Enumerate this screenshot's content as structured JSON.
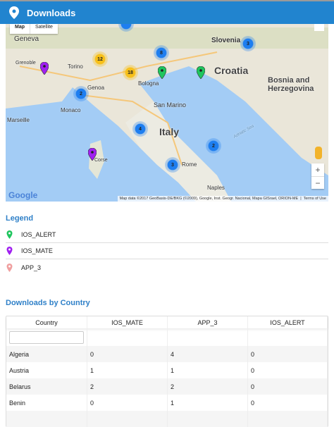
{
  "header": {
    "title": "Downloads",
    "icon": "map-marker-icon"
  },
  "map": {
    "map_type_buttons": [
      "Map",
      "Satellite"
    ],
    "labels": {
      "geneva": "Geneva",
      "slovenia": "Slovenia",
      "croatia": "Croatia",
      "bosnia": "Bosnia and Herzegovina",
      "grenoble": "Grenoble",
      "torino": "Torino",
      "genoa": "Genoa",
      "bologna": "Bologna",
      "monaco": "Monaco",
      "marseille": "Marseille",
      "san_marino": "San Marino",
      "italy": "Italy",
      "adriatic": "Adriatic Sea",
      "corse": "Corse",
      "rome": "Rome",
      "naples": "Naples"
    },
    "clusters": [
      "3",
      "8",
      "12",
      "18",
      "2",
      "4",
      "2",
      "3"
    ],
    "zoom_in": "+",
    "zoom_out": "−",
    "google": "Google",
    "attribution": "Map data ©2017 GeoBasis-DE/BKG (©2009), Google, Inst. Geogr. Nacional, Mapa GISrael, ORION-ME",
    "terms": "Terms of Use"
  },
  "legend": {
    "title": "Legend",
    "items": [
      {
        "label": "IOS_ALERT",
        "color": "#1fc55e"
      },
      {
        "label": "IOS_MATE",
        "color": "#a020f0"
      },
      {
        "label": "APP_3",
        "color": "#f0a0a0"
      }
    ]
  },
  "table": {
    "title": "Downloads by Country",
    "columns": [
      "Country",
      "IOS_MATE",
      "APP_3",
      "IOS_ALERT"
    ],
    "filter_placeholder": "",
    "rows": [
      [
        "Algeria",
        "0",
        "4",
        "0"
      ],
      [
        "Austria",
        "1",
        "1",
        "0"
      ],
      [
        "Belarus",
        "2",
        "2",
        "0"
      ],
      [
        "Benin",
        "0",
        "1",
        "0"
      ]
    ]
  }
}
